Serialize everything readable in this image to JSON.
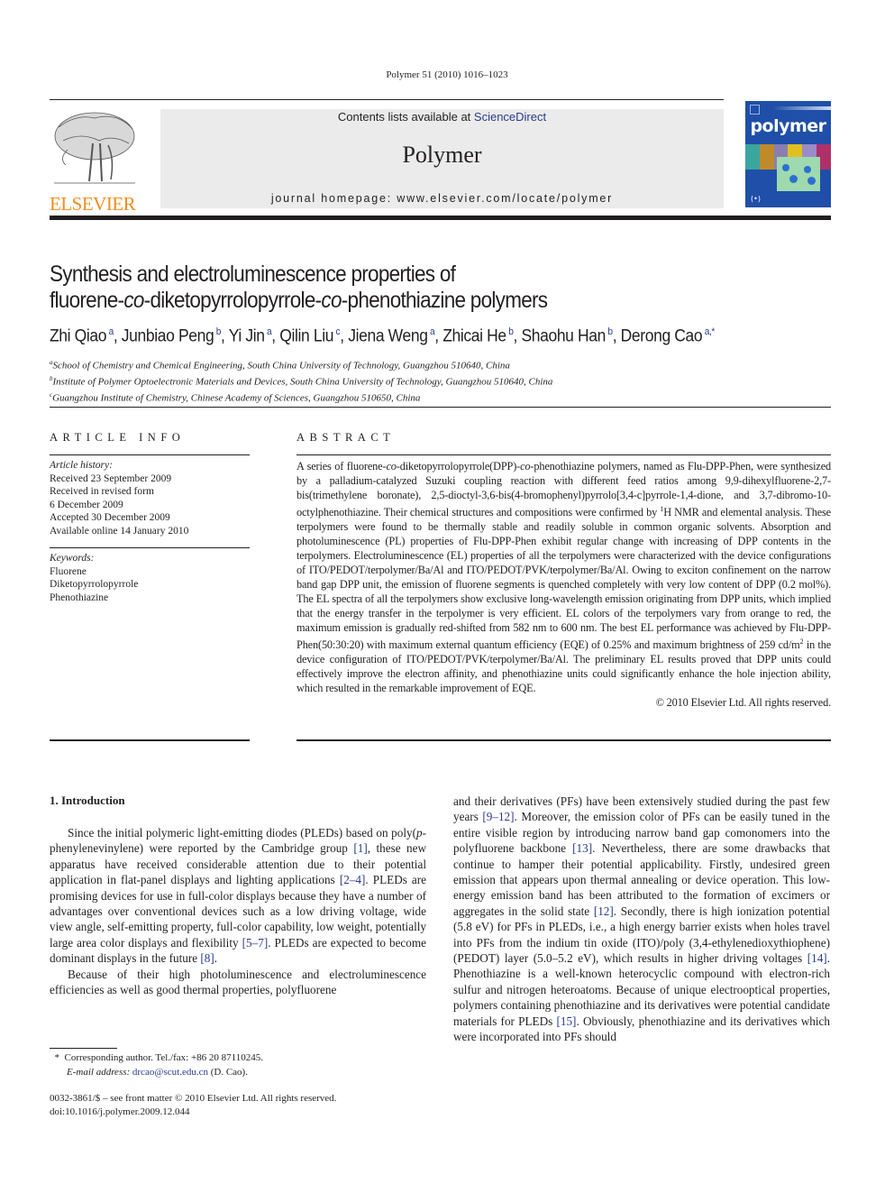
{
  "header": {
    "running_head": "Polymer 51 (2010) 1016–1023",
    "publisher_logo_word": "ELSEVIER",
    "contents_prefix": "Contents lists available at ",
    "contents_link": "ScienceDirect",
    "journal_name": "Polymer",
    "homepage_line": "journal homepage: www.elsevier.com/locate/polymer",
    "cover_title": "polymer"
  },
  "article": {
    "title_line1": "Synthesis and electroluminescence properties of",
    "title_line2_parts": [
      "fluorene-",
      "co",
      "-diketopyrrolopyrrole-",
      "co",
      "-phenothiazine polymers"
    ],
    "authors": [
      {
        "name": "Zhi Qiao",
        "aff": "a"
      },
      {
        "name": "Junbiao Peng",
        "aff": "b"
      },
      {
        "name": "Yi Jin",
        "aff": "a"
      },
      {
        "name": "Qilin Liu",
        "aff": "c"
      },
      {
        "name": "Jiena Weng",
        "aff": "a"
      },
      {
        "name": "Zhicai He",
        "aff": "b"
      },
      {
        "name": "Shaohu Han",
        "aff": "b"
      },
      {
        "name": "Derong Cao",
        "aff": "a,*"
      }
    ],
    "affiliations": [
      {
        "key": "a",
        "text": "School of Chemistry and Chemical Engineering, South China University of Technology, Guangzhou 510640, China"
      },
      {
        "key": "b",
        "text": "Institute of Polymer Optoelectronic Materials and Devices, South China University of Technology, Guangzhou 510640, China"
      },
      {
        "key": "c",
        "text": "Guangzhou Institute of Chemistry, Chinese Academy of Sciences, Guangzhou 510650, China"
      }
    ]
  },
  "article_info": {
    "heading": "ARTICLE INFO",
    "history_label": "Article history:",
    "history": [
      "Received 23 September 2009",
      "Received in revised form",
      "6 December 2009",
      "Accepted 30 December 2009",
      "Available online 14 January 2010"
    ],
    "keywords_label": "Keywords:",
    "keywords": [
      "Fluorene",
      "Diketopyrrolopyrrole",
      "Phenothiazine"
    ]
  },
  "abstract": {
    "heading": "ABSTRACT",
    "p1": "A series of fluorene-",
    "p1_it": "co",
    "p2": "-diketopyrrolopyrrole(DPP)-",
    "p2_it": "co",
    "p3": "-phenothiazine polymers, named as Flu-DPP-Phen, were synthesized by a palladium-catalyzed Suzuki coupling reaction with different feed ratios among 9,9-dihexylfluorene-2,7-bis(trimethylene boronate), 2,5-dioctyl-3,6-bis(4-bromophenyl)pyrrolo[3,4-c]pyrrole-1,4-dione, and 3,7-dibromo-10-octylphenothiazine. Their chemical structures and compositions were confirmed by ",
    "p3_sup": "1",
    "p4": "H NMR and elemental analysis. These terpolymers were found to be thermally stable and readily soluble in common organic solvents. Absorption and photoluminescence (PL) properties of Flu-DPP-Phen exhibit regular change with increasing of DPP contents in the terpolymers. Electroluminescence (EL) properties of all the terpolymers were characterized with the device configurations of ITO/PEDOT/terpolymer/Ba/Al and ITO/PEDOT/PVK/terpolymer/Ba/Al. Owing to exciton confinement on the narrow band gap DPP unit, the emission of fluorene segments is quenched completely with very low content of DPP (0.2 mol%). The EL spectra of all the terpolymers show exclusive long-wavelength emission originating from DPP units, which implied that the energy transfer in the terpolymer is very efficient. EL colors of the terpolymers vary from orange to red, the maximum emission is gradually red-shifted from 582 nm to 600 nm. The best EL performance was achieved by Flu-DPP-Phen(50:30:20) with maximum external quantum efficiency (EQE) of 0.25% and maximum brightness of 259 cd/m",
    "p4_sup": "2",
    "p5": " in the device configuration of ITO/PEDOT/PVK/terpolymer/Ba/Al. The preliminary EL results proved that DPP units could effectively improve the electron affinity, and phenothiazine units could significantly enhance the hole injection ability, which resulted in the remarkable improvement of EQE.",
    "copyright": "© 2010 Elsevier Ltd. All rights reserved."
  },
  "intro": {
    "heading": "1.  Introduction",
    "left_para1": [
      {
        "t": "Since the initial polymeric light-emitting diodes (PLEDs) based on poly("
      },
      {
        "i": "p"
      },
      {
        "t": "-phenylenevinylene) were reported by the Cambridge group "
      },
      {
        "r": "[1]"
      },
      {
        "t": ", these new apparatus have received considerable attention due to their potential application in flat-panel displays and lighting applications "
      },
      {
        "r": "[2–4]"
      },
      {
        "t": ". PLEDs are promising devices for use in full-color displays because they have a number of advantages over conventional devices such as a low driving voltage, wide view angle, self-emitting property, full-color capability, low weight, potentially large area color displays and flexibility "
      },
      {
        "r": "[5–7]"
      },
      {
        "t": ". PLEDs are expected to become dominant displays in the future "
      },
      {
        "r": "[8]"
      },
      {
        "t": "."
      }
    ],
    "left_para2": [
      {
        "t": "Because of their high photoluminescence and electroluminescence efficiencies as well as good thermal properties, polyfluorene"
      }
    ],
    "right_para": [
      {
        "t": "and their derivatives (PFs) have been extensively studied during the past few years "
      },
      {
        "r": "[9–12]"
      },
      {
        "t": ". Moreover, the emission color of PFs can be easily tuned in the entire visible region by introducing narrow band gap comonomers into the polyfluorene backbone "
      },
      {
        "r": "[13]"
      },
      {
        "t": ". Nevertheless, there are some drawbacks that continue to hamper their potential applicability. Firstly, undesired green emission that appears upon thermal annealing or device operation. This low-energy emission band has been attributed to the formation of excimers or aggregates in the solid state "
      },
      {
        "r": "[12]"
      },
      {
        "t": ". Secondly, there is high ionization potential (5.8 eV) for PFs in PLEDs, i.e., a high energy barrier exists when holes travel into PFs from the indium tin oxide (ITO)/poly (3,4-ethylenedioxythiophene) (PEDOT) layer (5.0–5.2 eV), which results in higher driving voltages "
      },
      {
        "r": "[14]"
      },
      {
        "t": ". Phenothiazine is a well-known heterocyclic compound with electron-rich sulfur and nitrogen heteroatoms. Because of unique electrooptical properties, polymers containing phenothiazine and its derivatives were potential candidate materials for PLEDs "
      },
      {
        "r": "[15]"
      },
      {
        "t": ". Obviously, phenothiazine and its derivatives which were incorporated into PFs should"
      }
    ]
  },
  "footnote": {
    "star": "*",
    "corresponding": "Corresponding author. Tel./fax: +86 20 87110245.",
    "email_label": "E-mail address: ",
    "email": "drcao@scut.edu.cn",
    "email_suffix": " (D. Cao)."
  },
  "front_matter": {
    "issn_line": "0032-3861/$ – see front matter © 2010 Elsevier Ltd. All rights reserved.",
    "doi": "doi:10.1016/j.polymer.2009.12.044"
  },
  "colors": {
    "link": "#2a3a8c",
    "elsevier_orange": "#f28c1e",
    "banner_bg": "#ebebeb",
    "cover_blue": "#1f4fa8"
  }
}
